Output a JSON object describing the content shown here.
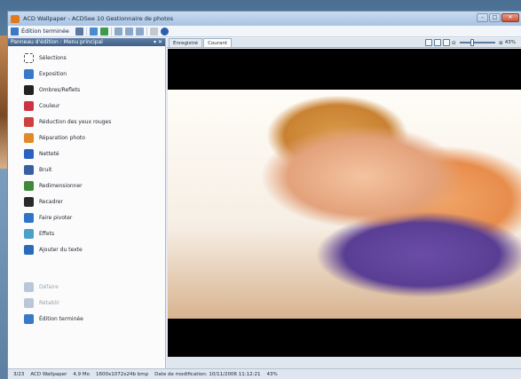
{
  "window": {
    "title": "ACD Wallpaper - ACDSee 10 Gestionnaire de photos"
  },
  "toolbar": {
    "edit_done_label": "Édition terminée"
  },
  "panel": {
    "title": "Panneau d'édition : Menu principal",
    "items": [
      {
        "label": "Sélections",
        "icon": "selection-icon",
        "color": "#ffffff"
      },
      {
        "label": "Exposition",
        "icon": "exposure-icon",
        "color": "#3a78c8"
      },
      {
        "label": "Ombres/Reflets",
        "icon": "shadows-highlights-icon",
        "color": "#222222"
      },
      {
        "label": "Couleur",
        "icon": "color-icon",
        "color": "#cc3344"
      },
      {
        "label": "Réduction des yeux rouges",
        "icon": "red-eye-icon",
        "color": "#d04040"
      },
      {
        "label": "Réparation photo",
        "icon": "photo-repair-icon",
        "color": "#e08a2a"
      },
      {
        "label": "Netteté",
        "icon": "sharpness-icon",
        "color": "#2b62c0"
      },
      {
        "label": "Bruit",
        "icon": "noise-icon",
        "color": "#3a5fa0"
      },
      {
        "label": "Redimensionner",
        "icon": "resize-icon",
        "color": "#3f8a3a"
      },
      {
        "label": "Recadrer",
        "icon": "crop-icon",
        "color": "#2a2a2a"
      },
      {
        "label": "Faire pivoter",
        "icon": "rotate-icon",
        "color": "#2f74c8"
      },
      {
        "label": "Effets",
        "icon": "effects-icon",
        "color": "#4aa0c8"
      },
      {
        "label": "Ajouter du texte",
        "icon": "add-text-icon",
        "color": "#2a6ab8"
      }
    ],
    "actions": [
      {
        "label": "Défaire",
        "icon": "undo-icon",
        "color": "#6a88b0",
        "disabled": true
      },
      {
        "label": "Rétablir",
        "icon": "redo-icon",
        "color": "#6a88b0",
        "disabled": true
      },
      {
        "label": "Édition terminée",
        "icon": "edit-done-icon",
        "color": "#3a78c8",
        "disabled": false
      }
    ]
  },
  "tabs": [
    {
      "label": "Enregistré",
      "active": false
    },
    {
      "label": "Courant",
      "active": true
    }
  ],
  "zoom": {
    "level": "43%"
  },
  "status": {
    "index": "3/23",
    "name": "ACD Wallpaper",
    "size": "4,9 Mo",
    "dims": "1600x1072x24b bmp",
    "modified": "Date de modification: 10/11/2006 11:12:21",
    "zoom": "43%"
  }
}
